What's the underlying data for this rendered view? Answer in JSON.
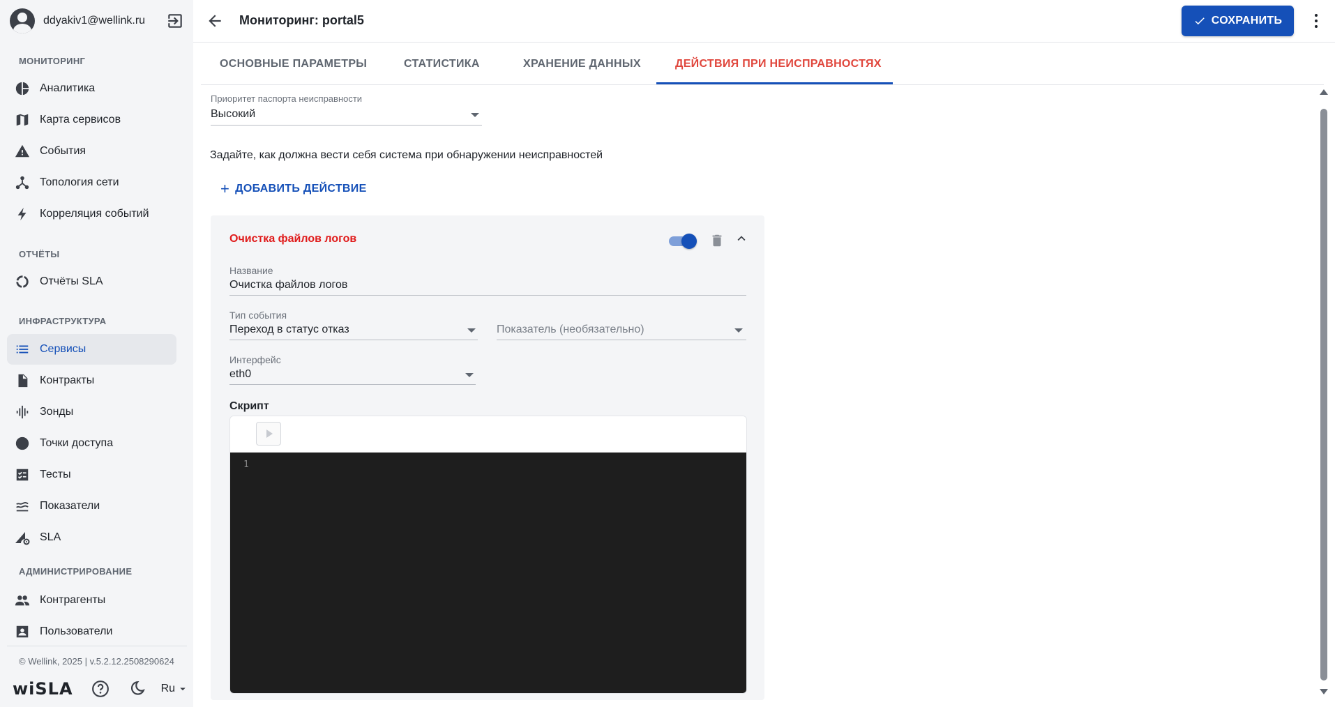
{
  "user": {
    "email": "ddyakiv1@wellink.ru"
  },
  "sidebar": {
    "sections": [
      {
        "label": "МОНИТОРИНГ"
      },
      {
        "label": "ОТЧЁТЫ"
      },
      {
        "label": "ИНФРАСТРУКТУРА"
      },
      {
        "label": "АДМИНИСТРИРОВАНИЕ"
      }
    ],
    "items": [
      {
        "label": "Аналитика",
        "icon": "pie-chart-icon"
      },
      {
        "label": "Карта сервисов",
        "icon": "map-icon"
      },
      {
        "label": "События",
        "icon": "warning-icon"
      },
      {
        "label": "Топология сети",
        "icon": "topology-icon"
      },
      {
        "label": "Корреляция событий",
        "icon": "bolt-icon"
      },
      {
        "label": "Отчёты SLA",
        "icon": "donut-icon"
      },
      {
        "label": "Сервисы",
        "icon": "list-icon",
        "active": true
      },
      {
        "label": "Контракты",
        "icon": "document-icon"
      },
      {
        "label": "Зонды",
        "icon": "signal-icon"
      },
      {
        "label": "Точки доступа",
        "icon": "circle-icon"
      },
      {
        "label": "Тесты",
        "icon": "checklist-icon"
      },
      {
        "label": "Показатели",
        "icon": "waves-icon"
      },
      {
        "label": "SLA",
        "icon": "sla-gear-icon"
      },
      {
        "label": "Контрагенты",
        "icon": "people-icon"
      },
      {
        "label": "Пользователи",
        "icon": "user-card-icon"
      }
    ],
    "copyright": "© Wellink, 2025 | v.5.2.12.2508290624",
    "brand": "wiSLA",
    "language": "Ru"
  },
  "header": {
    "title": "Мониторинг: portal5",
    "save_label": "СОХРАНИТЬ"
  },
  "tabs": [
    {
      "label": "ОСНОВНЫЕ ПАРАМЕТРЫ"
    },
    {
      "label": "СТАТИСТИКА"
    },
    {
      "label": "ХРАНЕНИЕ ДАННЫХ"
    },
    {
      "label": "ДЕЙСТВИЯ ПРИ НЕИСПРАВНОСТЯХ",
      "active": true
    }
  ],
  "priority": {
    "label": "Приоритет паспорта неисправности",
    "value": "Высокий"
  },
  "hint": "Задайте, как должна вести себя система при обнаружении неисправностей",
  "add_action_label": "ДОБАВИТЬ ДЕЙСТВИЕ",
  "action": {
    "title": "Очистка файлов логов",
    "enabled": true,
    "name": {
      "label": "Название",
      "value": "Очистка файлов логов"
    },
    "event_type": {
      "label": "Тип события",
      "value": "Переход в статус отказ"
    },
    "metric": {
      "placeholder": "Показатель (необязательно)"
    },
    "interface": {
      "label": "Интерфейс",
      "value": "eth0"
    },
    "script": {
      "label": "Скрипт",
      "line_number": "1"
    }
  },
  "colors": {
    "accent": "#1550b8",
    "active_tab": "#e0463c",
    "action_title": "#e01b1b",
    "editor_bg": "#1e1e1e"
  }
}
